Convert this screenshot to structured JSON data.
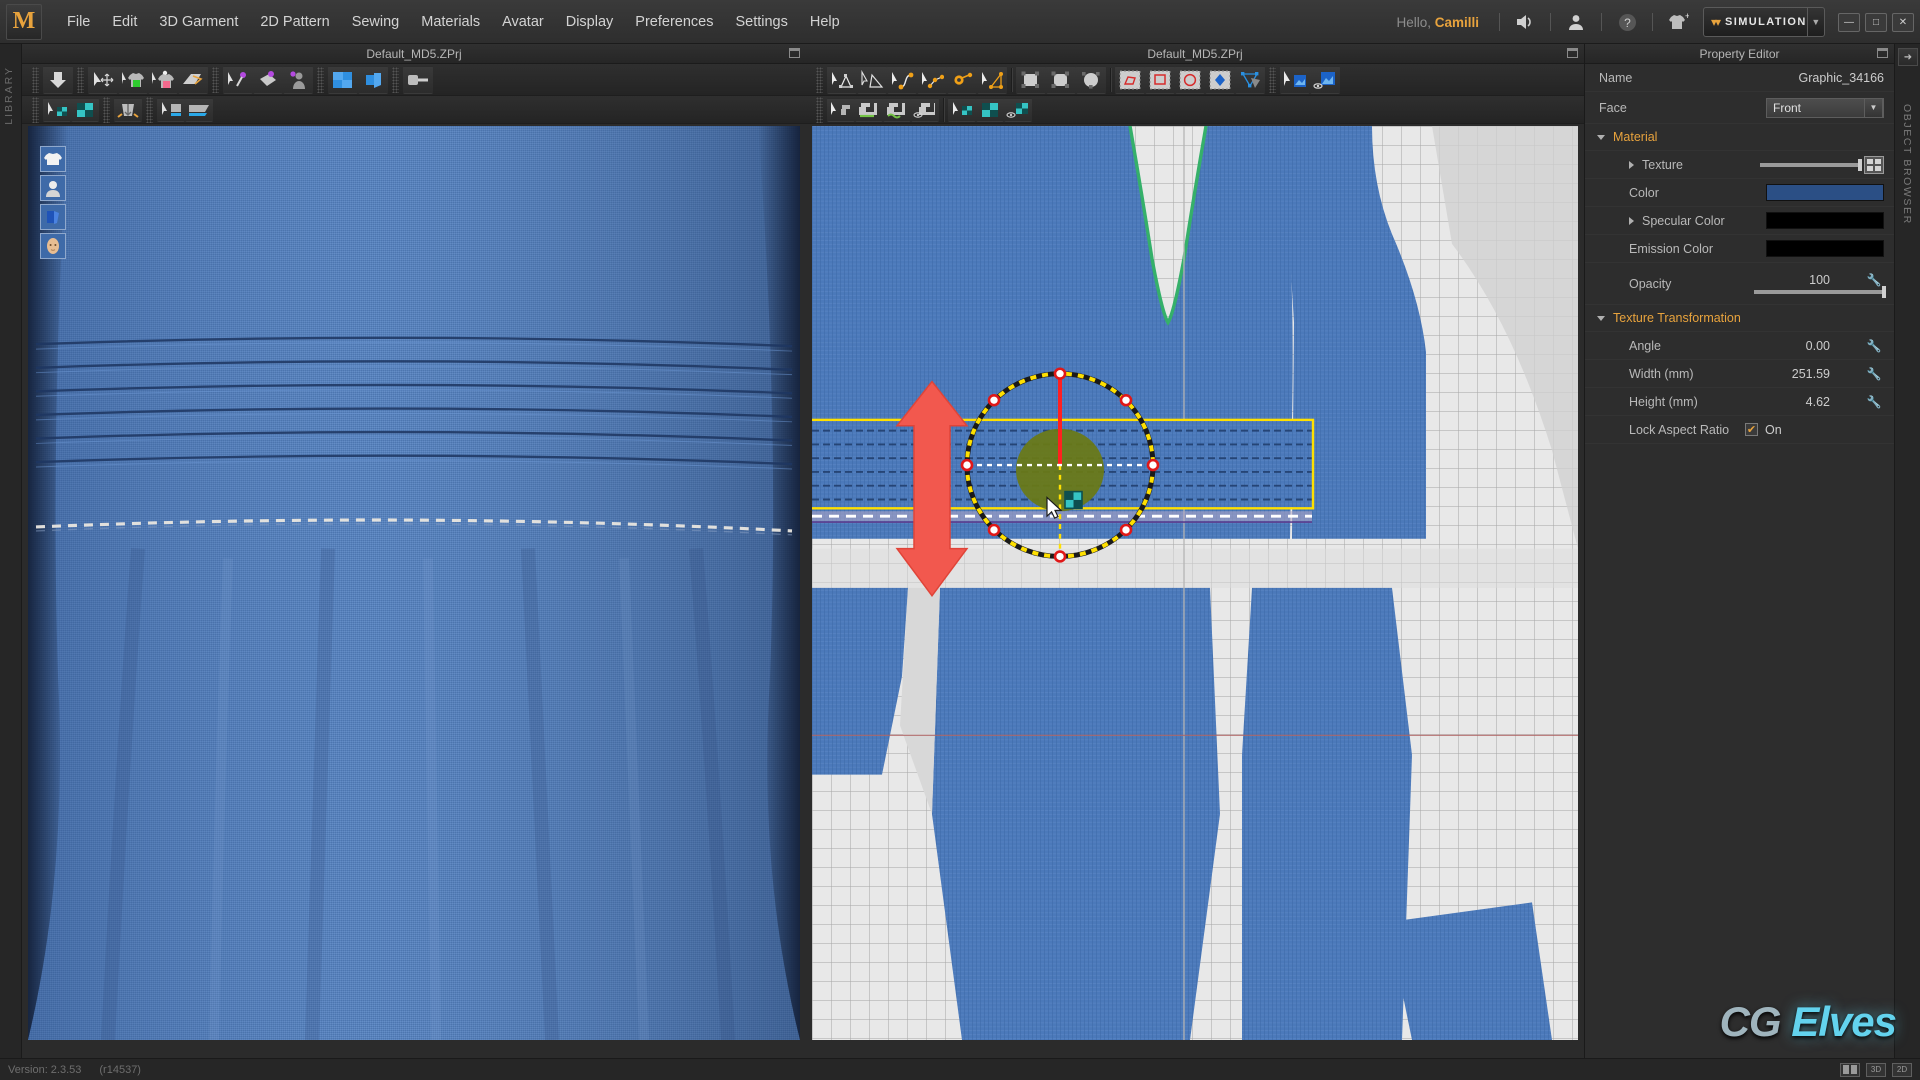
{
  "app": {
    "logo_letter": "M",
    "library_rail_label": "LIBRARY",
    "object_browser_label": "OBJECT BROWSER"
  },
  "menubar": {
    "items": [
      "File",
      "Edit",
      "3D Garment",
      "2D Pattern",
      "Sewing",
      "Materials",
      "Avatar",
      "Display",
      "Preferences",
      "Settings",
      "Help"
    ],
    "greeting_prefix": "Hello, ",
    "user_name": "Camilli",
    "icons": [
      "speaker-icon",
      "user-icon",
      "help-icon",
      "garment-add-icon"
    ],
    "mode_selector": {
      "label": "SIMULATION",
      "chevron": "»"
    },
    "window_buttons": [
      "minimize",
      "maximize",
      "close"
    ]
  },
  "viewport_3d": {
    "title": "Default_MD5.ZPrj",
    "toolbar_row1": [
      "arrange-garment-icon",
      "select-move-icon",
      "select-mesh-green-icon",
      "select-mesh-pink-icon",
      "flatten-icon",
      "select-pin-icon",
      "pin-fabric-icon",
      "pin-avatar-icon",
      "fold-arrange-icon",
      "box-arrange-icon",
      "tape-measure-icon"
    ],
    "toolbar_row2": [
      "select-texture-icon",
      "texture-edit-icon",
      "gravity-icon",
      "select-layer-icon",
      "layer-plane-icon"
    ],
    "overlay_icons": [
      "garment-thumbnail-icon",
      "avatar-thumbnail-icon",
      "fabric-thumbnail-icon",
      "skin-thumbnail-icon"
    ]
  },
  "viewport_2d": {
    "title": "Default_MD5.ZPrj",
    "toolbar_row1": [
      "edit-pattern-icon",
      "edit-curve-point-icon",
      "edit-curvature-icon",
      "add-point-split-icon",
      "move-point-icon",
      "polygon-edit-icon",
      "rectangle-pattern-icon",
      "round-rect-pattern-icon",
      "circle-pattern-icon",
      "internal-polygon-icon",
      "internal-rect-icon",
      "internal-circle-icon",
      "internal-line-icon",
      "dart-icon",
      "trace-icon",
      "select-graphic-icon",
      "edit-graphic-icon"
    ],
    "toolbar_row2": [
      "select-seam-icon",
      "segment-sewing-icon",
      "free-sewing-icon",
      "sewing-edit-icon",
      "select-texture-icon",
      "texture-move-icon",
      "texture-eye-icon"
    ],
    "gizmo": {
      "name": "texture-transform-gizmo",
      "rotation_handle_color": "#ff2a2a",
      "ring_color": "#ffe000",
      "center_color": "#6b7a16",
      "bbox_color": "#ffe000",
      "annotation_arrow": {
        "name": "vertical-drag-arrow",
        "color": "#f2584e",
        "direction": "up-down"
      }
    }
  },
  "property_editor": {
    "title": "Property Editor",
    "fields": {
      "name_label": "Name",
      "name_value": "Graphic_34166",
      "face_label": "Face",
      "face_value": "Front"
    },
    "material": {
      "section_label": "Material",
      "texture_label": "Texture",
      "color_label": "Color",
      "color_value": "#2b4f85",
      "specular_label": "Specular Color",
      "specular_value": "#000000",
      "emission_label": "Emission Color",
      "emission_value": "#000000",
      "opacity_label": "Opacity",
      "opacity_value": "100"
    },
    "texture_transformation": {
      "section_label": "Texture Transformation",
      "angle_label": "Angle",
      "angle_value": "0.00",
      "width_label": "Width (mm)",
      "width_value": "251.59",
      "height_label": "Height (mm)",
      "height_value": "4.62",
      "lock_label": "Lock Aspect Ratio",
      "lock_value": "On"
    }
  },
  "statusbar": {
    "version_label": "Version: 2.3.53",
    "revision": "(r14537)",
    "view_buttons": [
      "split-view",
      "3D",
      "2D"
    ]
  },
  "watermark": {
    "part1": "CG",
    "part2": " Elves"
  }
}
